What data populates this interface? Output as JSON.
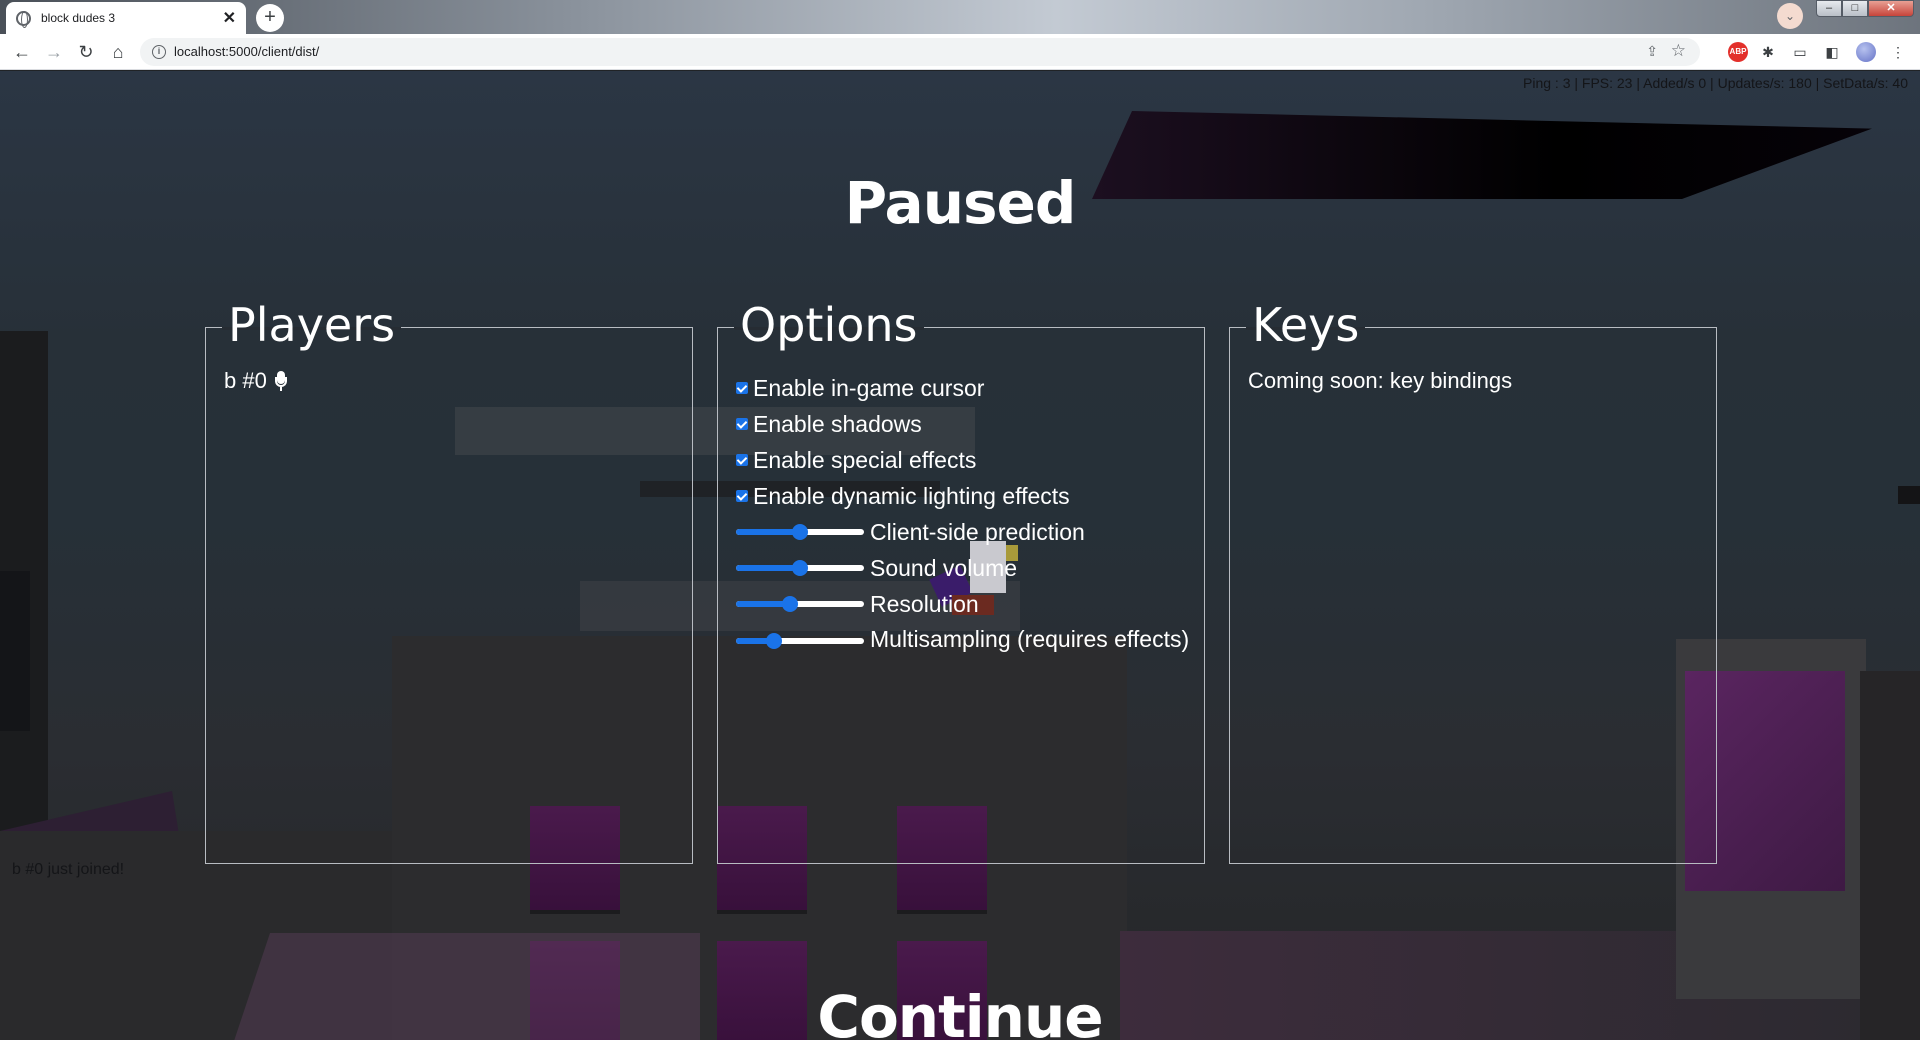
{
  "browser": {
    "tab_title": "block dudes 3",
    "tab_close": "✕",
    "new_tab": "+",
    "url": "localhost:5000/client/dist/",
    "window_buttons": {
      "minimize": "–",
      "maximize": "□",
      "close": "✕"
    }
  },
  "stats": "Ping : 3 | FPS: 23 | Added/s 0 | Updates/s: 180 | SetData/s: 40",
  "pause": {
    "title": "Paused",
    "continue_label": "Continue"
  },
  "players": {
    "legend": "Players",
    "list": [
      {
        "name": "b #0",
        "icon": "microphone-icon"
      }
    ]
  },
  "options": {
    "legend": "Options",
    "checkboxes": [
      {
        "label": "Enable in-game cursor",
        "checked": true
      },
      {
        "label": "Enable shadows",
        "checked": true
      },
      {
        "label": "Enable special effects",
        "checked": true
      },
      {
        "label": "Enable dynamic lighting effects",
        "checked": true
      }
    ],
    "sliders": [
      {
        "label": "Client-side prediction",
        "value": 0.5
      },
      {
        "label": "Sound volume",
        "value": 0.5
      },
      {
        "label": "Resolution",
        "value": 0.42
      },
      {
        "label": "Multisampling (requires effects)",
        "value": 0.3
      }
    ]
  },
  "keys": {
    "legend": "Keys",
    "text": "Coming soon: key bindings"
  },
  "chat": {
    "messages": [
      "b #0 just joined!"
    ]
  },
  "colors": {
    "accent": "#1a73e8",
    "text": "#ffffff",
    "panel_border": "#b8bcc2"
  }
}
